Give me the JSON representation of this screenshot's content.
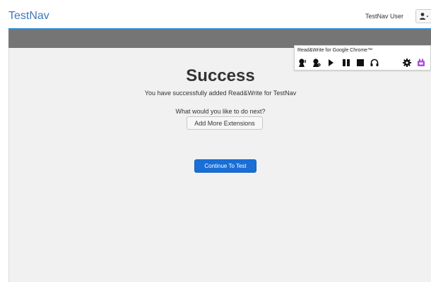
{
  "header": {
    "logo": "TestNav",
    "user_label": "TestNav User",
    "user_icon": "user-icon"
  },
  "main": {
    "title": "Success",
    "subtitle": "You have successfully added Read&Write for TestNav",
    "question": "What would you like to do next?",
    "add_more_label": "Add More Extensions",
    "continue_label": "Continue To Test"
  },
  "rw_toolbar": {
    "title": "Read&Write for Google Chrome™",
    "icons": [
      "speaker-user-icon",
      "speaker-gear-icon",
      "play-icon",
      "pause-icon",
      "stop-icon",
      "headphones-icon",
      "settings-icon",
      "purple-app-icon"
    ]
  },
  "colors": {
    "accent_blue": "#2b8fd6",
    "logo_blue": "#3f78b7",
    "band_grey": "#757575",
    "button_blue": "#1a6fd6",
    "toolbar_purple": "#b04fd8"
  }
}
